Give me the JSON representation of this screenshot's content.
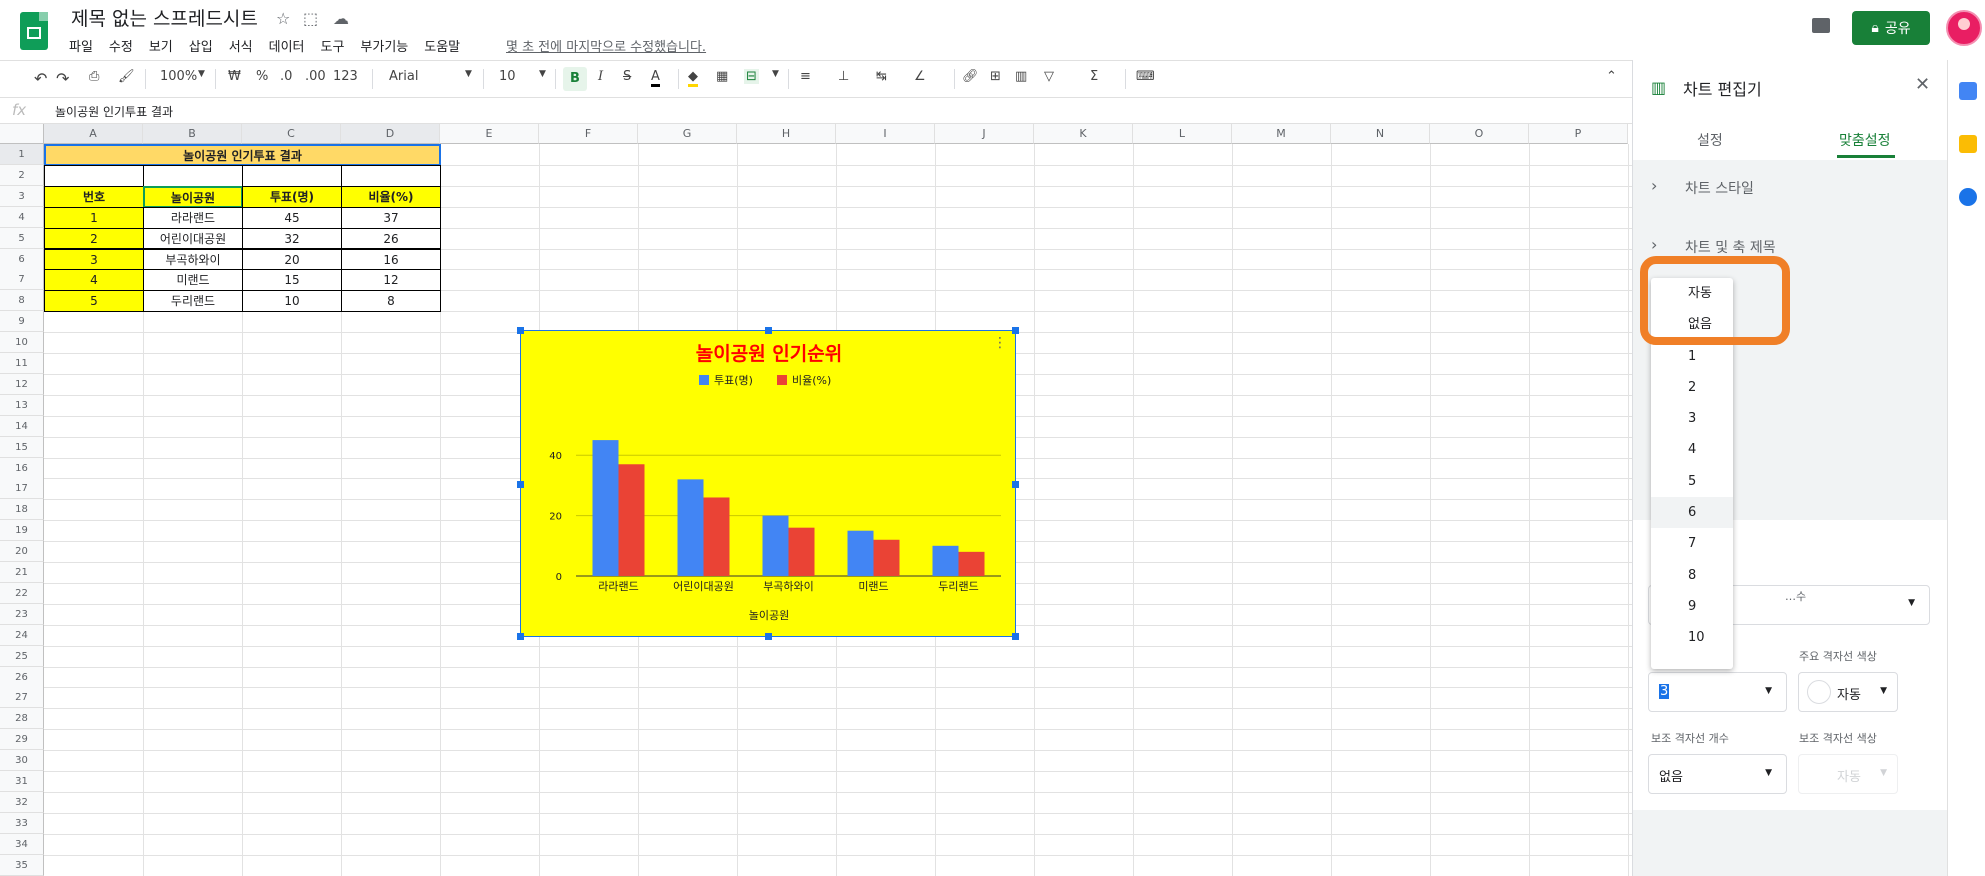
{
  "app": {
    "title": "제목 없는 스프레드시트",
    "last_edit": "몇 초 전에 마지막으로 수정했습니다.",
    "share_label": "공유",
    "menu": [
      "파일",
      "수정",
      "보기",
      "삽입",
      "서식",
      "데이터",
      "도구",
      "부가기능",
      "도움말"
    ]
  },
  "toolbar": {
    "zoom": "100%",
    "currency": "₩",
    "percent": "%",
    "dec_less": ".0",
    "dec_more": ".00",
    "format": "123",
    "font": "Arial",
    "size": "10",
    "bold": "B",
    "italic": "I",
    "strike": "S",
    "color": "A",
    "sigma": "Σ"
  },
  "formula": {
    "fx": "fx",
    "content": "놀이공원 인기투표 결과"
  },
  "grid": {
    "columns": [
      "A",
      "B",
      "C",
      "D",
      "E",
      "F",
      "G",
      "H",
      "I",
      "J",
      "K",
      "L",
      "M",
      "N",
      "O",
      "P"
    ],
    "rows": [
      "1",
      "2",
      "3",
      "4",
      "5",
      "6",
      "7",
      "8",
      "9",
      "10",
      "11",
      "12",
      "13",
      "14",
      "15",
      "16",
      "17",
      "18",
      "19",
      "20",
      "21",
      "22",
      "23",
      "24",
      "25",
      "26",
      "27",
      "28",
      "29",
      "30",
      "31",
      "32",
      "33",
      "34",
      "35"
    ]
  },
  "table": {
    "title": "놀이공원 인기투표 결과",
    "headers": [
      "번호",
      "놀이공원",
      "투표(명)",
      "비율(%)"
    ],
    "rows": [
      [
        "1",
        "라라랜드",
        "45",
        "37"
      ],
      [
        "2",
        "어린이대공원",
        "32",
        "26"
      ],
      [
        "3",
        "부곡하와이",
        "20",
        "16"
      ],
      [
        "4",
        "미랜드",
        "15",
        "12"
      ],
      [
        "5",
        "두리랜드",
        "10",
        "8"
      ]
    ]
  },
  "chart_data": {
    "type": "bar",
    "title": "놀이공원 인기순위",
    "xlabel": "놀이공원",
    "ylabel": "",
    "categories": [
      "라라랜드",
      "어린이대공원",
      "부곡하와이",
      "미랜드",
      "두리랜드"
    ],
    "series": [
      {
        "name": "투표(명)",
        "values": [
          45,
          32,
          20,
          15,
          10
        ],
        "color": "#4285f4"
      },
      {
        "name": "비율(%)",
        "values": [
          37,
          26,
          16,
          12,
          8
        ],
        "color": "#ea4335"
      }
    ],
    "ylim": [
      0,
      50
    ],
    "yticks": [
      "0",
      "20",
      "40"
    ],
    "grid": true,
    "legend": "top",
    "background": "#ffff00",
    "title_color": "#ff0000"
  },
  "panel": {
    "title": "차트 편집기",
    "tab_setup": "설정",
    "tab_custom": "맞춤설정",
    "section_style": "차트 스타일",
    "section_titles": "차트 및 축 제목",
    "major_count_label": "…수",
    "major_color_label": "주요 격자선 색상",
    "major_count_value": "3",
    "major_color_value": "자동",
    "minor_count_label": "보조 격자선 개수",
    "minor_color_label": "보조 격자선 색상",
    "minor_count_value": "없음",
    "minor_color_value": "자동"
  },
  "dropdown": {
    "options": [
      "자동",
      "없음",
      "1",
      "2",
      "3",
      "4",
      "5",
      "6",
      "7",
      "8",
      "9",
      "10"
    ],
    "highlighted": "6"
  },
  "colors": {
    "accent": "#188038",
    "select": "#1a73e8",
    "highlight": "#f07f27"
  }
}
